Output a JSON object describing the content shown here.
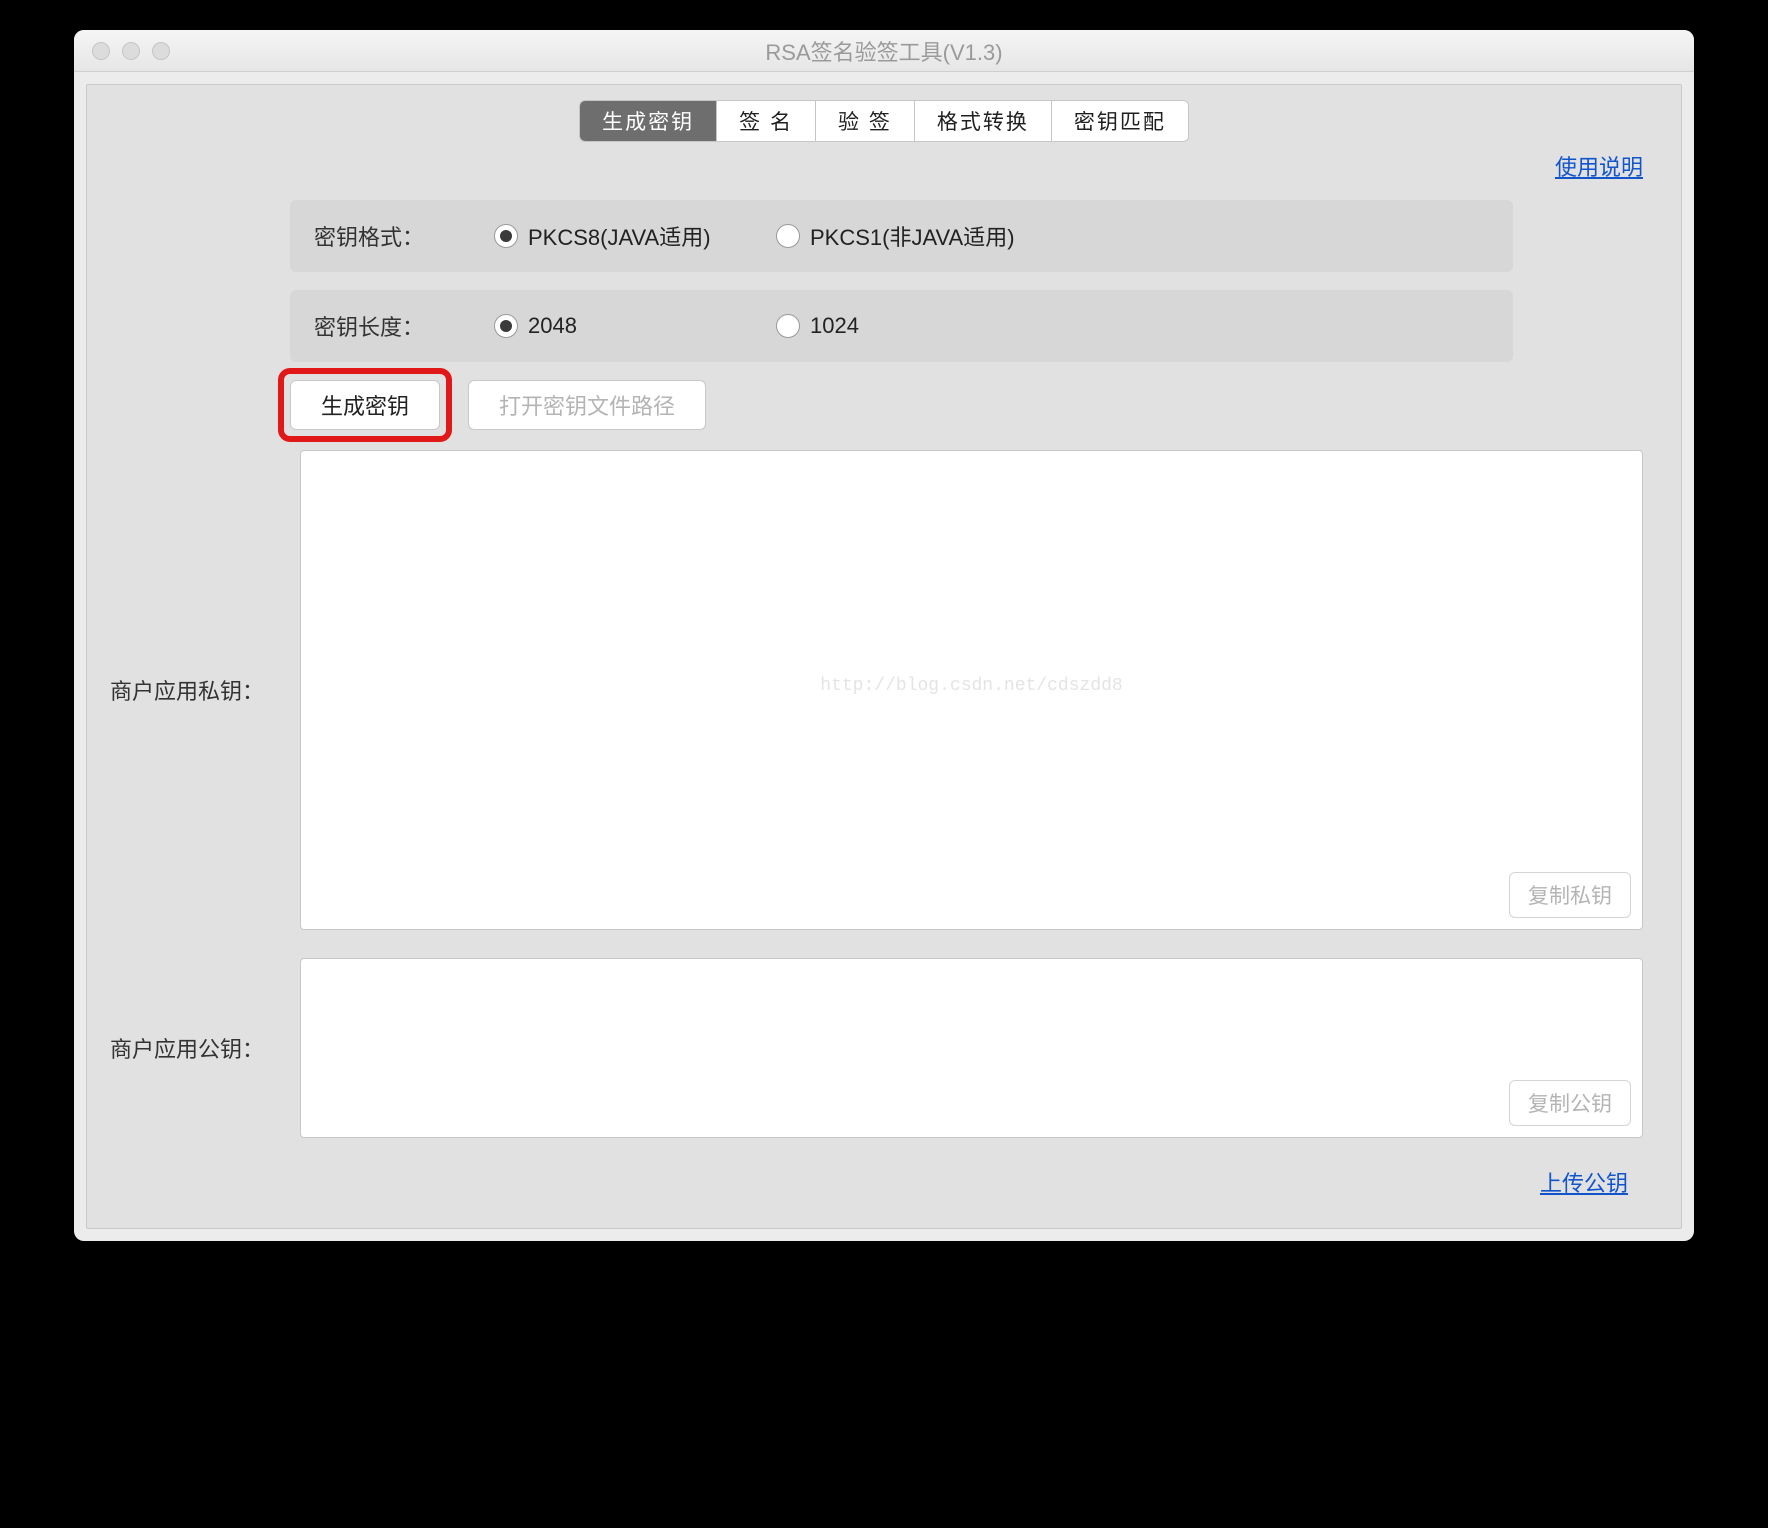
{
  "window": {
    "title": "RSA签名验签工具(V1.3)"
  },
  "tabs": {
    "items": [
      {
        "label": "生成密钥",
        "active": true
      },
      {
        "label": "签 名",
        "active": false
      },
      {
        "label": "验 签",
        "active": false
      },
      {
        "label": "格式转换",
        "active": false
      },
      {
        "label": "密钥匹配",
        "active": false
      }
    ]
  },
  "links": {
    "help": "使用说明",
    "upload": "上传公钥"
  },
  "options": {
    "format": {
      "label": "密钥格式：",
      "items": [
        {
          "label": "PKCS8(JAVA适用)",
          "checked": true
        },
        {
          "label": "PKCS1(非JAVA适用)",
          "checked": false
        }
      ]
    },
    "length": {
      "label": "密钥长度：",
      "items": [
        {
          "label": "2048",
          "checked": true
        },
        {
          "label": "1024",
          "checked": false
        }
      ]
    }
  },
  "buttons": {
    "generate": "生成密钥",
    "openPath": "打开密钥文件路径",
    "copyPrivate": "复制私钥",
    "copyPublic": "复制公钥"
  },
  "sections": {
    "privateKey": {
      "label": "商户应用私钥："
    },
    "publicKey": {
      "label": "商户应用公钥："
    }
  },
  "watermark": "http://blog.csdn.net/cdszdd8"
}
